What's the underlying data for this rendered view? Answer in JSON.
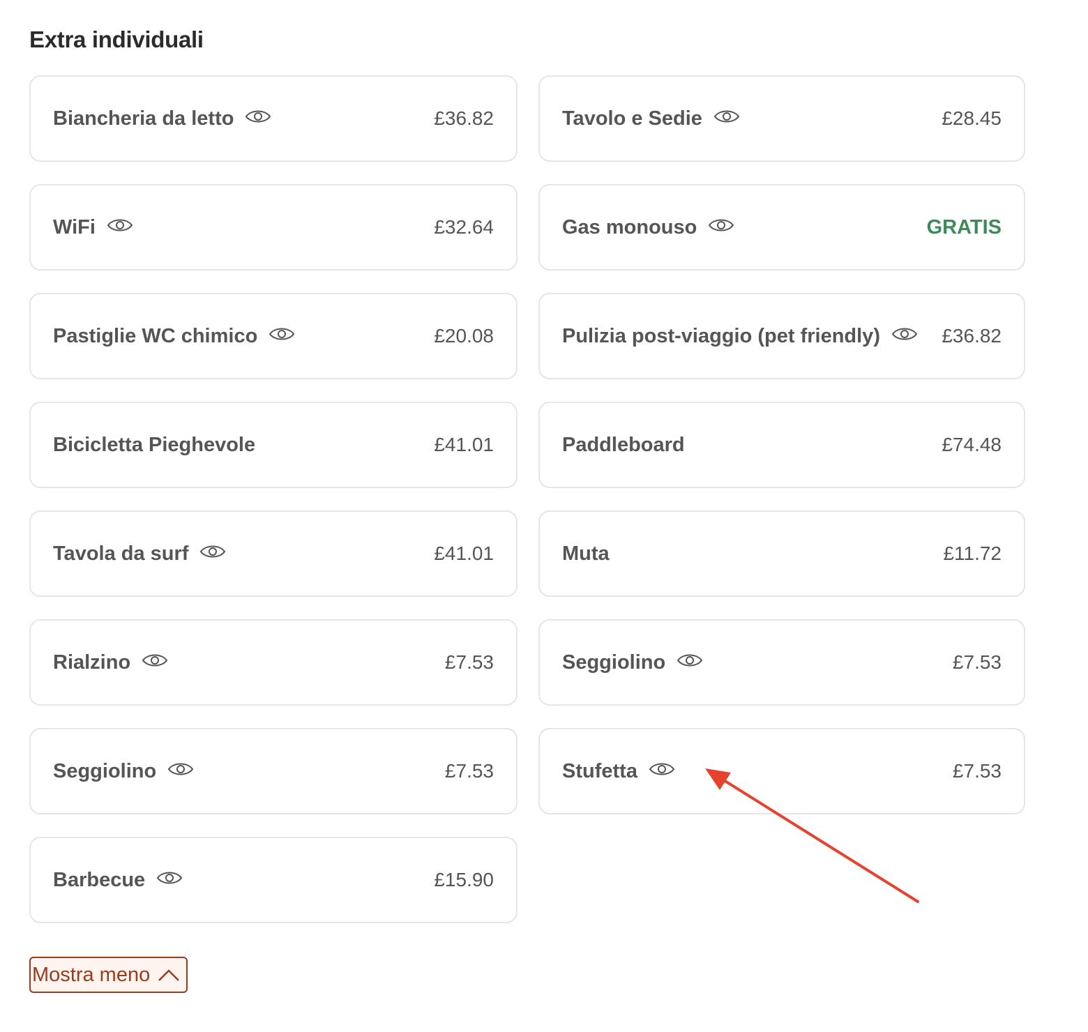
{
  "section": {
    "title": "Extra individuali"
  },
  "extras": [
    {
      "name": "Biancheria da letto",
      "price": "£36.82",
      "has_info": true,
      "free": false
    },
    {
      "name": "Tavolo e Sedie",
      "price": "£28.45",
      "has_info": true,
      "free": false
    },
    {
      "name": "WiFi",
      "price": "£32.64",
      "has_info": true,
      "free": false
    },
    {
      "name": "Gas monouso",
      "price": "GRATIS",
      "has_info": true,
      "free": true
    },
    {
      "name": "Pastiglie WC chimico",
      "price": "£20.08",
      "has_info": true,
      "free": false
    },
    {
      "name": "Pulizia post-viaggio (pet friendly)",
      "price": "£36.82",
      "has_info": true,
      "free": false
    },
    {
      "name": "Bicicletta Pieghevole",
      "price": "£41.01",
      "has_info": false,
      "free": false
    },
    {
      "name": "Paddleboard",
      "price": "£74.48",
      "has_info": false,
      "free": false
    },
    {
      "name": "Tavola da surf",
      "price": "£41.01",
      "has_info": true,
      "free": false
    },
    {
      "name": "Muta",
      "price": "£11.72",
      "has_info": false,
      "free": false
    },
    {
      "name": "Rialzino",
      "price": "£7.53",
      "has_info": true,
      "free": false
    },
    {
      "name": "Seggiolino",
      "price": "£7.53",
      "has_info": true,
      "free": false
    },
    {
      "name": "Seggiolino",
      "price": "£7.53",
      "has_info": true,
      "free": false
    },
    {
      "name": "Stufetta",
      "price": "£7.53",
      "has_info": true,
      "free": false
    },
    {
      "name": "Barbecue",
      "price": "£15.90",
      "has_info": true,
      "free": false
    }
  ],
  "toggle": {
    "label": "Mostra meno",
    "icon": "chevron-up-icon"
  },
  "colors": {
    "free_price": "#3d8a5a",
    "accent": "#9c3b1c",
    "annotation_arrow": "#e5432d"
  }
}
